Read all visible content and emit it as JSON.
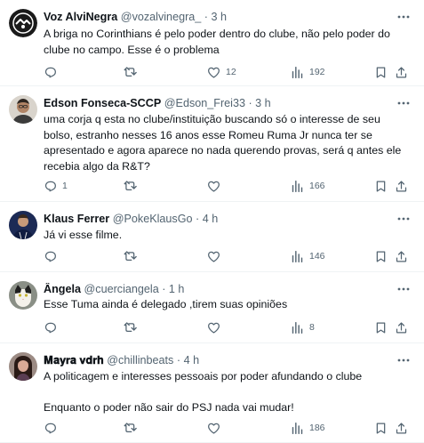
{
  "tweets": [
    {
      "name": "Voz AlviNegra",
      "handle": "@vozalvinegra_",
      "dot": "·",
      "time": "3 h",
      "text": "A briga no Corinthians é pelo poder dentro do clube, não pelo poder do clube no campo. Esse é o problema",
      "reply_count": "",
      "retweet_count": "",
      "like_count": "12",
      "view_count": "192"
    },
    {
      "name": "Edson Fonseca-SCCP",
      "handle": "@Edson_Frei33",
      "dot": "·",
      "time": "3 h",
      "text": "uma corja q esta no clube/instituição buscando só o interesse de seu bolso, estranho nesses 16 anos esse Romeu Ruma Jr nunca ter se apresentado e agora aparece no nada querendo provas, será q antes ele recebia algo da R&T?",
      "reply_count": "1",
      "retweet_count": "",
      "like_count": "",
      "view_count": "166"
    },
    {
      "name": "Klaus Ferrer",
      "handle": "@PokeKlausGo",
      "dot": "·",
      "time": "4 h",
      "text": "Já vi esse filme.",
      "reply_count": "",
      "retweet_count": "",
      "like_count": "",
      "view_count": "146"
    },
    {
      "name": "Ângela",
      "handle": "@cuerciangela",
      "dot": "·",
      "time": "1 h",
      "text": "Esse Tuma ainda é delegado ,tirem suas opiniões",
      "reply_count": "",
      "retweet_count": "",
      "like_count": "",
      "view_count": "8"
    },
    {
      "name": "𝐌𝐚𝐲𝐫𝐚 𝐯𝐝𝐫𝐡",
      "handle": "@chillinbeats",
      "dot": "·",
      "time": "4 h",
      "text": "A politicagem e interesses pessoais por poder afundando o clube\n\nEnquanto o poder não sair do PSJ nada vai mudar!",
      "reply_count": "",
      "retweet_count": "",
      "like_count": "",
      "view_count": "186"
    }
  ],
  "icons": {
    "reply": "reply-icon",
    "retweet": "retweet-icon",
    "like": "like-heart-icon",
    "views": "views-bar-chart-icon",
    "bookmark": "bookmark-icon",
    "share": "share-icon",
    "more": "more-dots-icon"
  },
  "colors": {
    "text": "#0f1419",
    "secondary": "#536471",
    "divider": "#eff3f4"
  }
}
